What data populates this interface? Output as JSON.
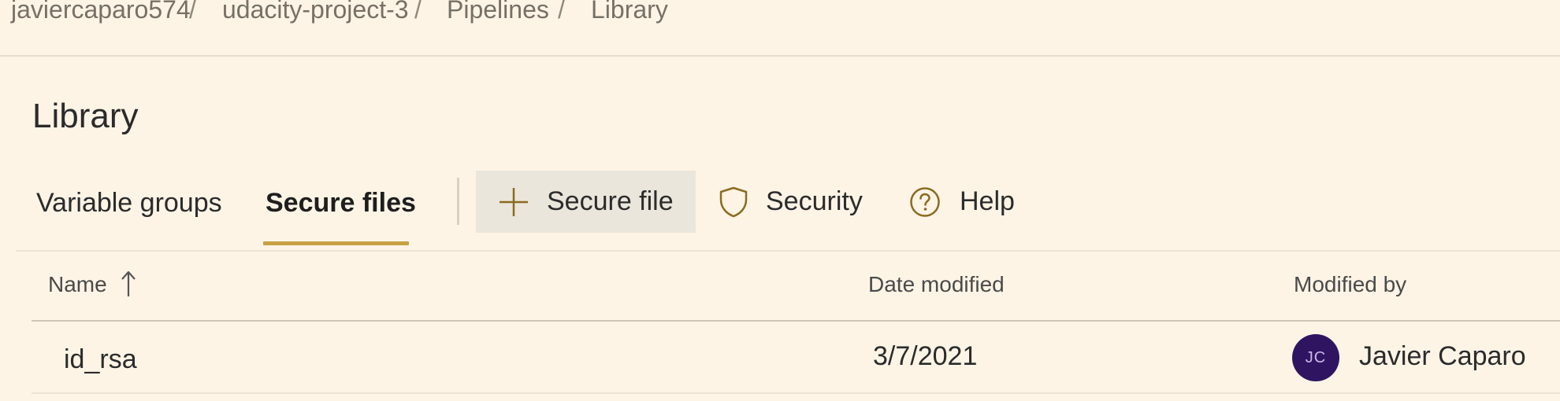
{
  "breadcrumb": {
    "items": [
      {
        "label": "javiercaparo574"
      },
      {
        "label": "udacity-project-3"
      },
      {
        "label": "Pipelines"
      },
      {
        "label": "Library"
      }
    ],
    "separator": "/"
  },
  "page": {
    "title": "Library"
  },
  "tabs": [
    {
      "label": "Variable groups",
      "active": false
    },
    {
      "label": "Secure files",
      "active": true
    }
  ],
  "toolbar": {
    "add_secure_file_label": "Secure file",
    "security_label": "Security",
    "help_label": "Help",
    "icons": {
      "add": "plus-icon",
      "security": "shield-icon",
      "help": "help-circle-icon"
    }
  },
  "table": {
    "columns": [
      {
        "label": "Name",
        "sort": "ascending"
      },
      {
        "label": "Date modified"
      },
      {
        "label": "Modified by"
      }
    ],
    "rows": [
      {
        "name": "id_rsa",
        "date_modified": "3/7/2021",
        "modified_by": {
          "initials": "JC",
          "name": "Javier Caparo"
        }
      }
    ]
  },
  "colors": {
    "background": "#fdf4e6",
    "accent": "#c8a144",
    "icon": "#8b6b1f",
    "avatar": "#2f1561",
    "button_bg": "#ebe6dc"
  }
}
